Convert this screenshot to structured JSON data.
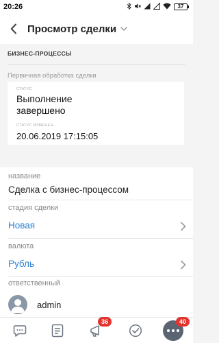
{
  "status_bar": {
    "time": "20:26",
    "battery": "37"
  },
  "header": {
    "title": "Просмотр сделки"
  },
  "business_processes": {
    "section_label": "БИЗНЕС-ПРОЦЕССЫ",
    "process_name": "Первичная обработка сделки",
    "status_caption": "СТАТУС",
    "status_value": "Выполнение завершено",
    "changed_caption": "СТАТУС ИЗМЕНЕН",
    "changed_value": "20.06.2019 17:15:05"
  },
  "fields": {
    "name_label": "название",
    "name_value": "Сделка с бизнес-процессом",
    "stage_label": "стадия сделки",
    "stage_value": "Новая",
    "currency_label": "валюта",
    "currency_value": "Рубль",
    "responsible_label": "ответственный",
    "responsible_value": "admin"
  },
  "tabbar": {
    "notifications_badge": "36",
    "more_badge": "40"
  },
  "colors": {
    "accent": "#2f82d1",
    "badge": "#e3342f"
  }
}
